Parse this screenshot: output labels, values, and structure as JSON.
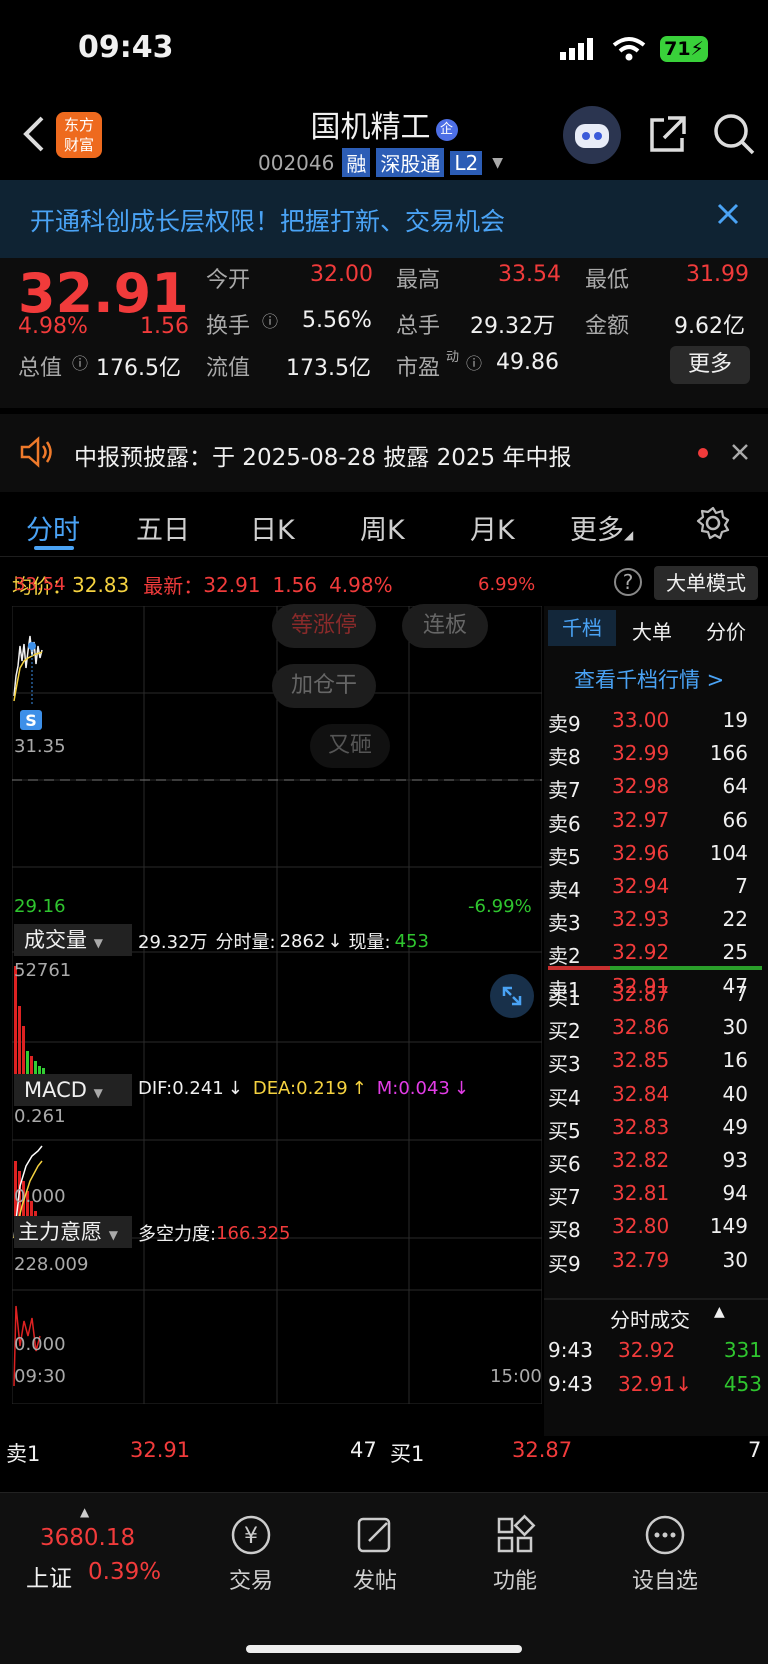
{
  "status_bar": {
    "time": "09:43",
    "battery": "71"
  },
  "header": {
    "title": "国机精工",
    "code": "002046",
    "badges": [
      "融",
      "深股通",
      "L2"
    ]
  },
  "banner": {
    "text": "开通科创成长层权限！把握打新、交易机会"
  },
  "quote": {
    "price": "32.91",
    "change_pct": "4.98%",
    "change": "1.56",
    "fields": {
      "open_label": "今开",
      "open": "32.00",
      "high_label": "最高",
      "high": "33.54",
      "low_label": "最低",
      "low": "31.99",
      "turnover_label": "换手",
      "turnover": "5.56%",
      "volume_label": "总手",
      "volume": "29.32万",
      "amount_label": "金额",
      "amount": "9.62亿",
      "mktcap_label": "总值",
      "mktcap": "176.5亿",
      "float_label": "流值",
      "float": "173.5亿",
      "pe_label": "市盈",
      "pe_sup": "动",
      "pe": "49.86",
      "more_button": "更多"
    }
  },
  "notice": {
    "text": "中报预披露：于 2025-08-28 披露 2025 年中报"
  },
  "tabs": [
    "分时",
    "五日",
    "日K",
    "周K",
    "月K",
    "更多"
  ],
  "info_line": {
    "avg_label": "均价：",
    "avg": "32.83",
    "last_label": "最新：",
    "last": "32.91",
    "chg": "1.56",
    "pct": "4.98%",
    "big_order_button": "大单模式"
  },
  "chart": {
    "y_top": "33.54",
    "y_top_pct": "6.99%",
    "y_mid": "31.35",
    "y_bottom": "29.16",
    "y_bottom_pct": "-6.99%",
    "overlay_buttons": [
      "等涨停",
      "连板",
      "加仓干",
      "又砸"
    ],
    "marker": "S"
  },
  "volume_panel": {
    "label": "成交量",
    "total": "29.32万",
    "min_label": "分时量:",
    "min_val": "2862",
    "now_label": "现量:",
    "now_val": "453",
    "ymax": "52761"
  },
  "macd_panel": {
    "label": "MACD",
    "dif": "DIF:0.241",
    "dea": "DEA:0.219",
    "m": "M:0.043",
    "ymax": "0.261",
    "ymin": "0.000"
  },
  "force_panel": {
    "label": "主力意愿",
    "index_label": "多空力度:",
    "index_val": "166.325",
    "ymax": "228.009",
    "ymin": "0.000",
    "t_start": "09:30",
    "t_end": "15:00"
  },
  "orderbook": {
    "tabs": [
      "千档",
      "大单",
      "分价"
    ],
    "link": "查看千档行情 >",
    "asks": [
      {
        "label": "卖9",
        "price": "33.00",
        "qty": "19"
      },
      {
        "label": "卖8",
        "price": "32.99",
        "qty": "166"
      },
      {
        "label": "卖7",
        "price": "32.98",
        "qty": "64"
      },
      {
        "label": "卖6",
        "price": "32.97",
        "qty": "66"
      },
      {
        "label": "卖5",
        "price": "32.96",
        "qty": "104"
      },
      {
        "label": "卖4",
        "price": "32.94",
        "qty": "7"
      },
      {
        "label": "卖3",
        "price": "32.93",
        "qty": "22"
      },
      {
        "label": "卖2",
        "price": "32.92",
        "qty": "25"
      },
      {
        "label": "卖1",
        "price": "32.91",
        "qty": "47"
      }
    ],
    "bids": [
      {
        "label": "买1",
        "price": "32.87",
        "qty": "7"
      },
      {
        "label": "买2",
        "price": "32.86",
        "qty": "30"
      },
      {
        "label": "买3",
        "price": "32.85",
        "qty": "16"
      },
      {
        "label": "买4",
        "price": "32.84",
        "qty": "40"
      },
      {
        "label": "买5",
        "price": "32.83",
        "qty": "49"
      },
      {
        "label": "买6",
        "price": "32.82",
        "qty": "93"
      },
      {
        "label": "买7",
        "price": "32.81",
        "qty": "94"
      },
      {
        "label": "买8",
        "price": "32.80",
        "qty": "149"
      },
      {
        "label": "买9",
        "price": "32.79",
        "qty": "30"
      }
    ],
    "ticks_title": "分时成交",
    "ticks": [
      {
        "time": "9:43",
        "price": "32.92",
        "qty": "331"
      },
      {
        "time": "9:43",
        "price": "32.91↓",
        "qty": "453"
      }
    ]
  },
  "bottom_quote": {
    "ask_label": "卖1",
    "ask_price": "32.91",
    "ask_qty": "47",
    "bid_label": "买1",
    "bid_price": "32.87",
    "bid_qty": "7"
  },
  "bottom_nav": {
    "index_value": "3680.18",
    "index_name": "上证",
    "index_pct": "0.39%",
    "items": [
      "交易",
      "发帖",
      "功能",
      "设自选"
    ]
  }
}
